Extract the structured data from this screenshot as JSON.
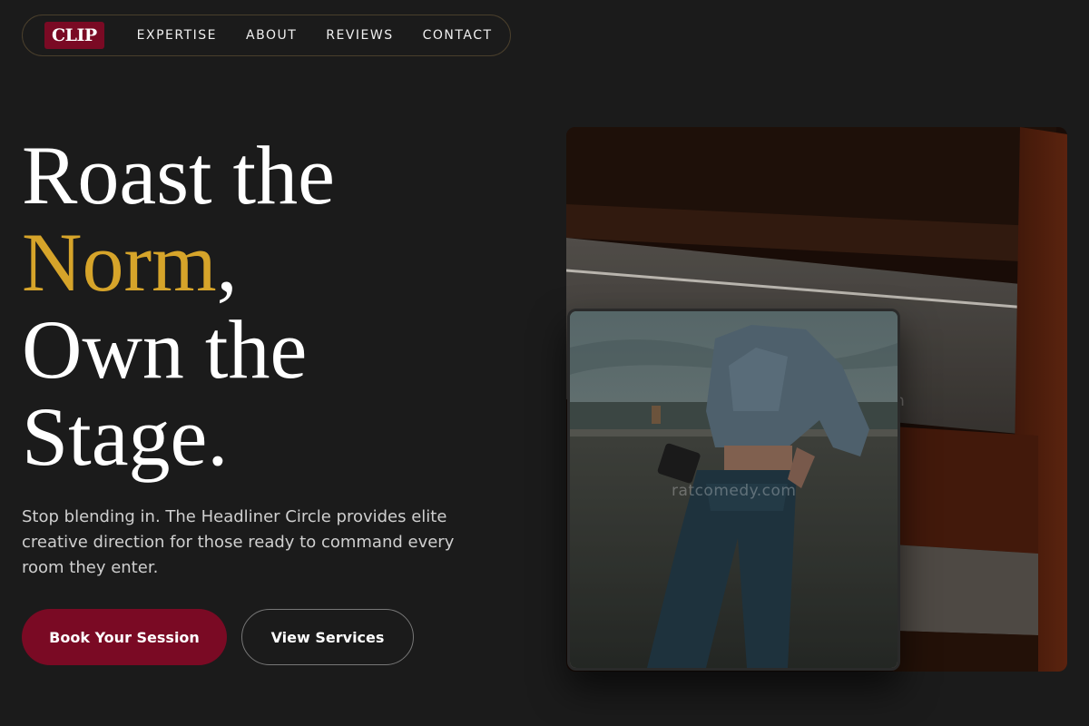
{
  "nav": {
    "logo": "CLIP",
    "links": [
      "EXPERTISE",
      "ABOUT",
      "REVIEWS",
      "CONTACT"
    ]
  },
  "hero": {
    "line1": "Roast the",
    "line2_accent": "Norm",
    "line2_rest": ",",
    "line3": "Own the",
    "line4": "Stage.",
    "subtext": "Stop blending in. The Headliner Circle provides elite creative direction for those ready to command every room they enter.",
    "primary_button": "Book Your Session",
    "secondary_button": "View Services"
  },
  "images": {
    "watermark": "ratcomedy.com"
  },
  "colors": {
    "background": "#1b1b1b",
    "accent_gold": "#d6a42a",
    "brand_red": "#7a0a24"
  }
}
